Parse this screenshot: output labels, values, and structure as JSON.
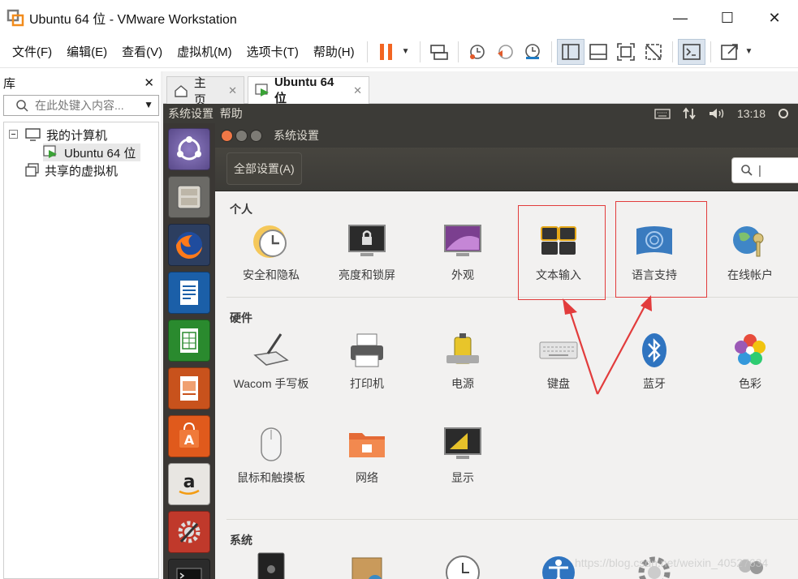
{
  "window": {
    "title": "Ubuntu 64 位 - VMware Workstation",
    "controls": {
      "minimize": "—",
      "maximize": "☐",
      "close": "✕"
    }
  },
  "menu": [
    "文件(F)",
    "编辑(E)",
    "查看(V)",
    "虚拟机(M)",
    "选项卡(T)",
    "帮助(H)"
  ],
  "library": {
    "title": "库",
    "close": "✕",
    "search_placeholder": "在此处键入内容...",
    "tree": {
      "my_computer": "我的计算机",
      "vm": "Ubuntu 64 位",
      "shared": "共享的虚拟机"
    }
  },
  "tabs": [
    {
      "label": "主页",
      "close": "✕"
    },
    {
      "label": "Ubuntu 64 位",
      "close": "✕"
    }
  ],
  "ubuntu": {
    "topbar_left": "系统设置  帮助",
    "time": "13:18",
    "window_title": "系统设置",
    "all_settings": "全部设置(A)",
    "search_cursor": "|"
  },
  "sections": {
    "personal": {
      "label": "个人",
      "items": [
        "安全和隐私",
        "亮度和锁屏",
        "外观",
        "文本输入",
        "语言支持",
        "在线帐户"
      ]
    },
    "hardware": {
      "label": "硬件",
      "items": [
        "Wacom 手写板",
        "打印机",
        "电源",
        "键盘",
        "蓝牙",
        "色彩",
        "鼠标和触摸板",
        "网络",
        "显示"
      ]
    },
    "system": {
      "label": "系统"
    }
  },
  "watermark": "https://blog.csdn.net/weixin_40527634",
  "colors": {
    "highlight": "#e23c3c",
    "ubuntu_panel": "#3c3b37",
    "launcher": "#3a3734",
    "pause_orange": "#f26522",
    "close_orange": "#f07746"
  }
}
